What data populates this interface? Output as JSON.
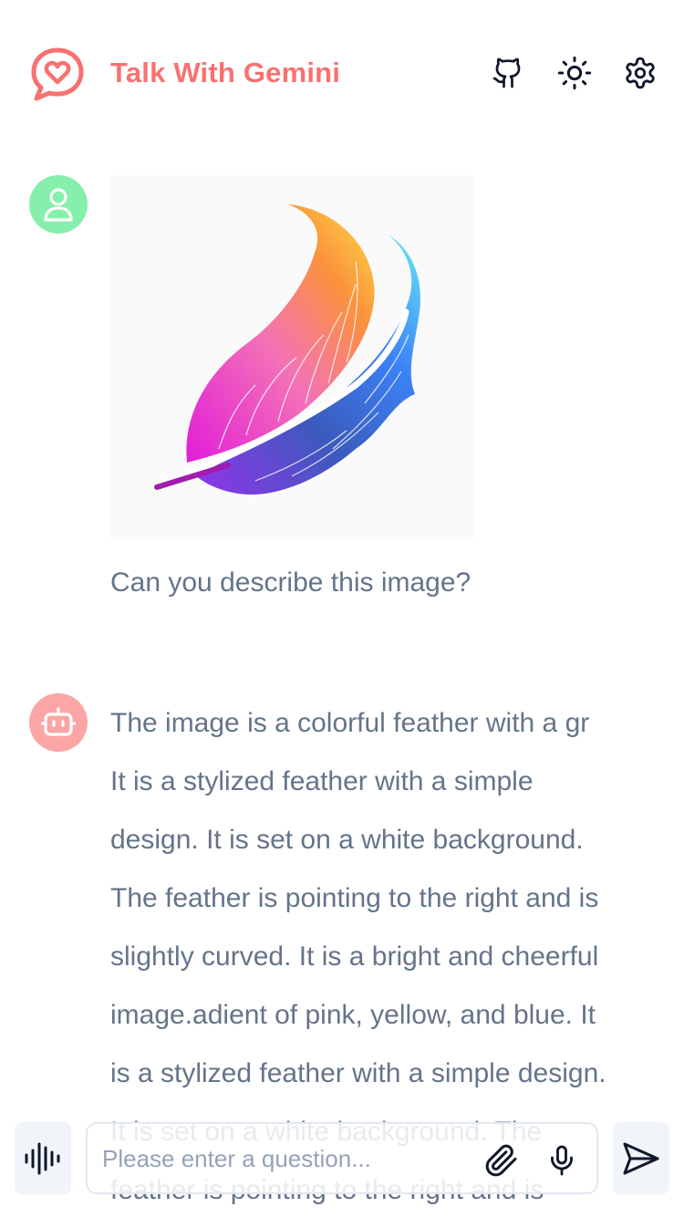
{
  "header": {
    "title": "Talk With Gemini",
    "logo_icon": "chat-heart-icon",
    "actions": [
      {
        "icon": "github-icon"
      },
      {
        "icon": "sun-icon"
      },
      {
        "icon": "gear-icon"
      }
    ]
  },
  "colors": {
    "brand": "#f87171",
    "user_avatar": "#86efac",
    "bot_avatar": "#fca5a5",
    "text": "#64748b"
  },
  "messages": [
    {
      "role": "user",
      "avatar_icon": "user-icon",
      "image": "colorful-feather-image",
      "text": "Can you describe this image?"
    },
    {
      "role": "bot",
      "avatar_icon": "robot-icon",
      "lines": [
        "The image is a colorful feather with a gr",
        "It is a stylized feather with a simple",
        "design. It is set on a white background.",
        "The feather is pointing to the right and is",
        "slightly curved. It is a bright and cheerful",
        "image.adient of pink, yellow, and blue. It",
        "is a stylized feather with a simple design.",
        "It is set on a white background. The",
        "feather is pointing to the right and is"
      ]
    }
  ],
  "input": {
    "placeholder": "Please enter a question...",
    "value": "",
    "voice_icon": "audio-waveform-icon",
    "attach_icon": "paperclip-icon",
    "mic_icon": "microphone-icon",
    "send_icon": "send-icon"
  }
}
